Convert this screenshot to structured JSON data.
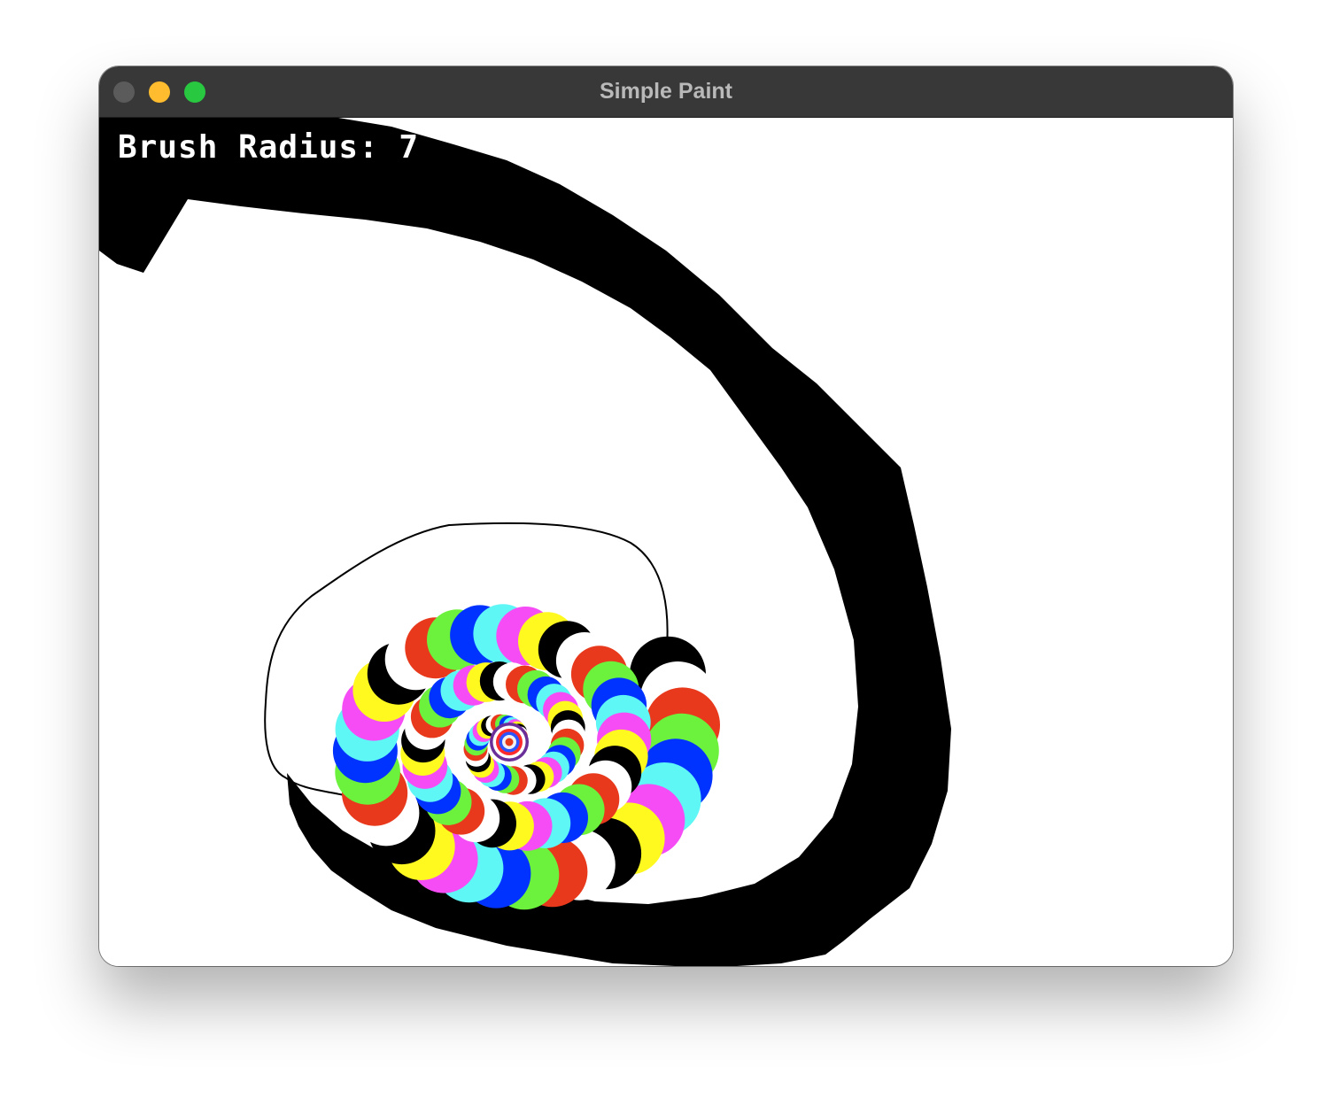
{
  "window": {
    "title": "Simple Paint",
    "controls": {
      "close_color": "#5b5b5b",
      "minimize_color": "#febc2e",
      "zoom_color": "#28c840"
    }
  },
  "canvas": {
    "background": "#ffffff",
    "brush_label": "Brush Radius: 7",
    "palette": [
      "#000000",
      "#ffffff",
      "#e8391c",
      "#6cf23c",
      "#0033ff",
      "#5ff6f6",
      "#f54cf5",
      "#fff91f"
    ]
  }
}
